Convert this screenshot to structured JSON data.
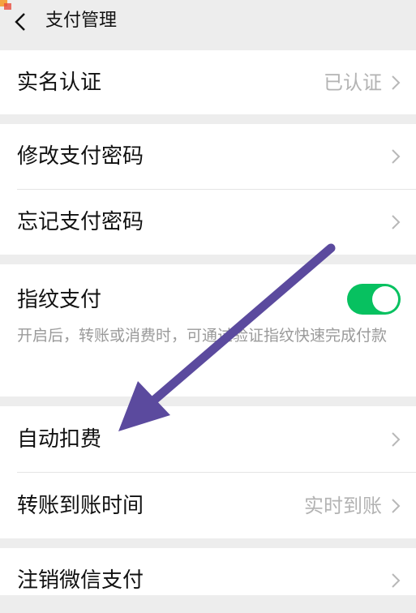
{
  "header": {
    "title": "支付管理"
  },
  "sections": {
    "verify": {
      "label": "实名认证",
      "value": "已认证"
    },
    "change_pwd": {
      "label": "修改支付密码"
    },
    "forgot_pwd": {
      "label": "忘记支付密码"
    },
    "fingerprint": {
      "label": "指纹支付",
      "enabled": true,
      "description": "开启后，转账或消费时，可通过验证指纹快速完成付款"
    },
    "auto_deduct": {
      "label": "自动扣费"
    },
    "transfer_time": {
      "label": "转账到账时间",
      "value": "实时到账"
    },
    "close_pay": {
      "label": "注销微信支付"
    }
  },
  "colors": {
    "toggle_on": "#07c160",
    "annotation_arrow": "#5b4a9e"
  }
}
